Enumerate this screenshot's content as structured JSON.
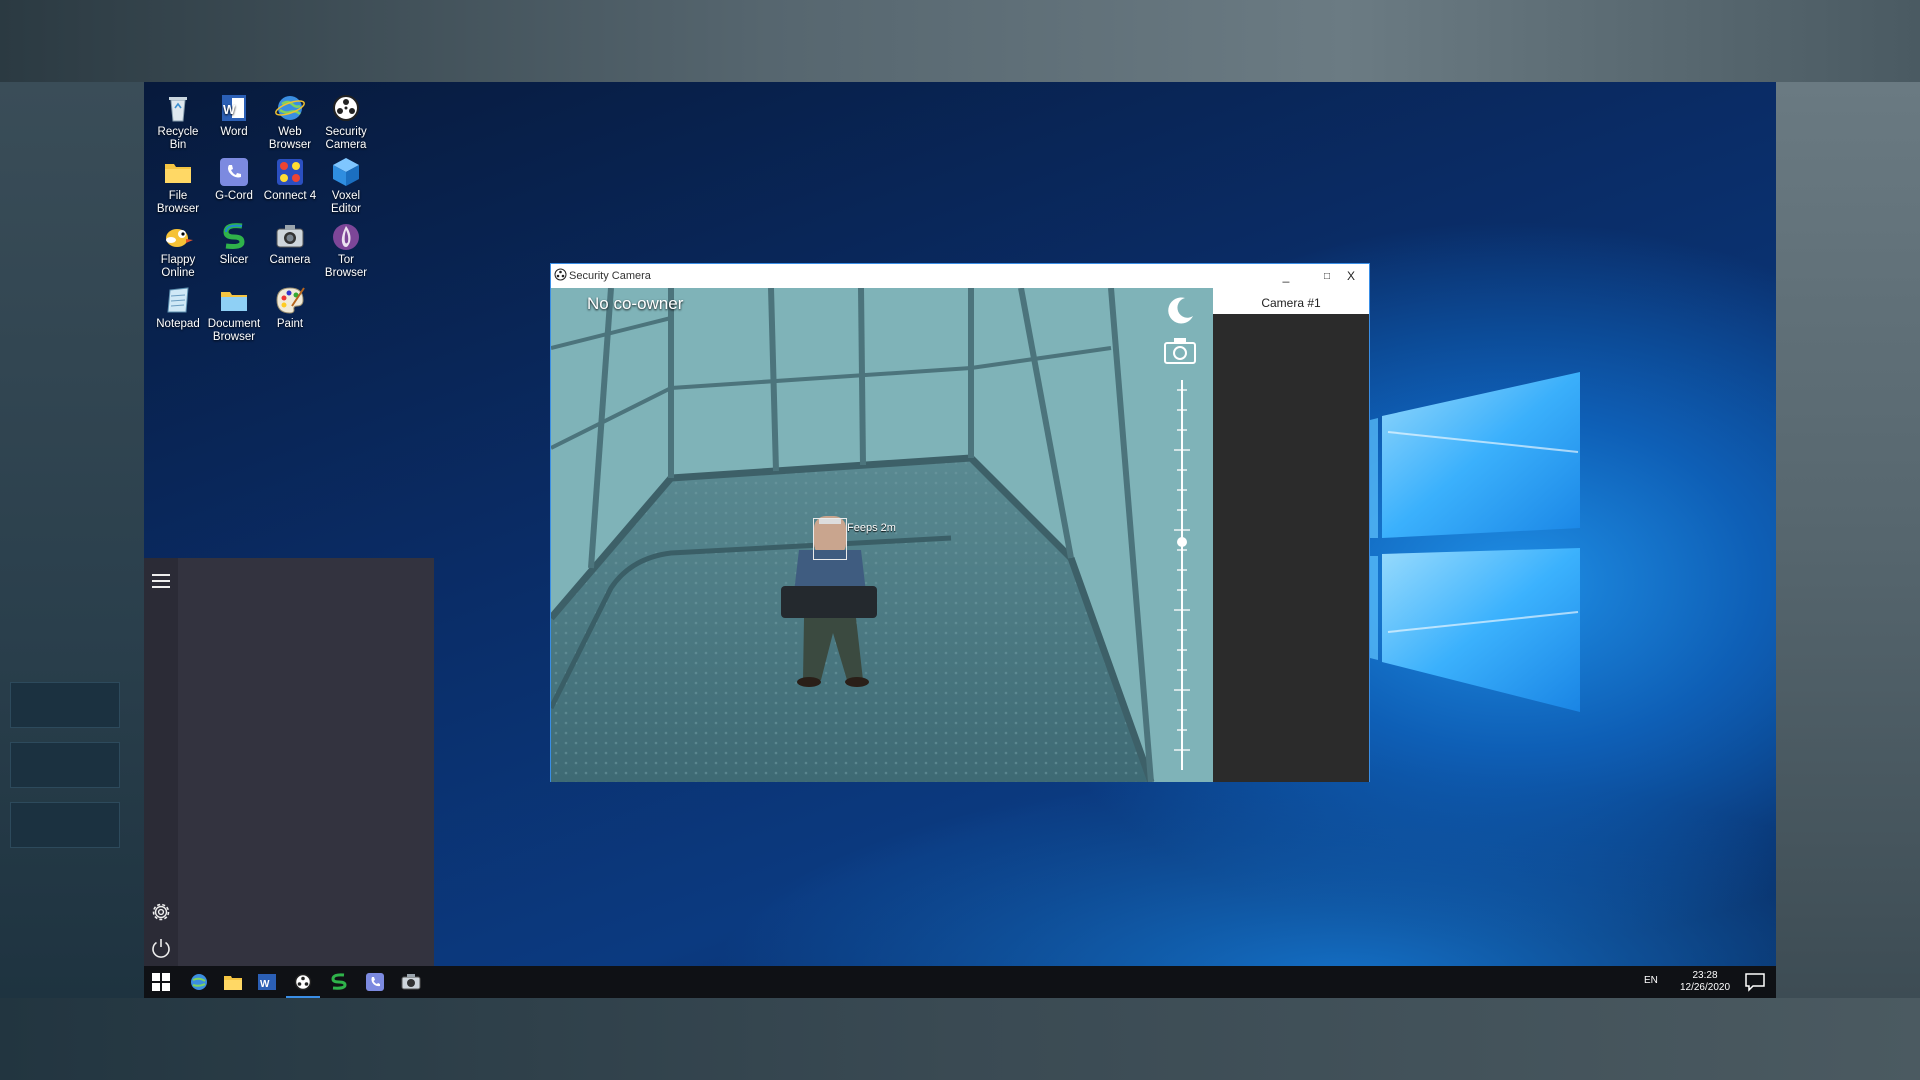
{
  "desktop": {
    "icons": [
      {
        "label": "Recycle Bin",
        "icon": "recycle-bin-icon"
      },
      {
        "label": "Word",
        "icon": "word-icon"
      },
      {
        "label": "Web Browser",
        "icon": "web-browser-icon"
      },
      {
        "label": "Security Camera",
        "icon": "security-camera-icon"
      },
      {
        "label": "File Browser",
        "icon": "folder-icon"
      },
      {
        "label": "G-Cord",
        "icon": "phone-icon"
      },
      {
        "label": "Connect 4",
        "icon": "connect4-icon"
      },
      {
        "label": "Voxel Editor",
        "icon": "cube-icon"
      },
      {
        "label": "Flappy Online",
        "icon": "bird-icon"
      },
      {
        "label": "Slicer",
        "icon": "slicer-icon"
      },
      {
        "label": "Camera",
        "icon": "camera-icon"
      },
      {
        "label": "Tor Browser",
        "icon": "onion-icon"
      },
      {
        "label": "Notepad",
        "icon": "notepad-icon"
      },
      {
        "label": "Document Browser",
        "icon": "document-folder-icon"
      },
      {
        "label": "Paint",
        "icon": "paint-palette-icon"
      }
    ]
  },
  "security_camera": {
    "window_title": "Security Camera",
    "co_owner_text": "No co-owner",
    "person_tag": "Feeps   2m",
    "camera_list": [
      "Camera #1"
    ],
    "window_buttons": {
      "minimize": "_",
      "maximize": "□",
      "close": "X"
    }
  },
  "taskbar": {
    "language": "EN",
    "time": "23:28",
    "date": "12/26/2020",
    "pinned": [
      "windows-start",
      "web-browser",
      "file-browser",
      "word",
      "security-camera",
      "slicer",
      "g-cord",
      "camera"
    ],
    "active": "security-camera"
  },
  "colors": {
    "accent": "#3a8ee6",
    "taskbar": "#0f1115",
    "start_menu": "#2b2b36",
    "cam_sidebar": "#2b2b2b"
  }
}
